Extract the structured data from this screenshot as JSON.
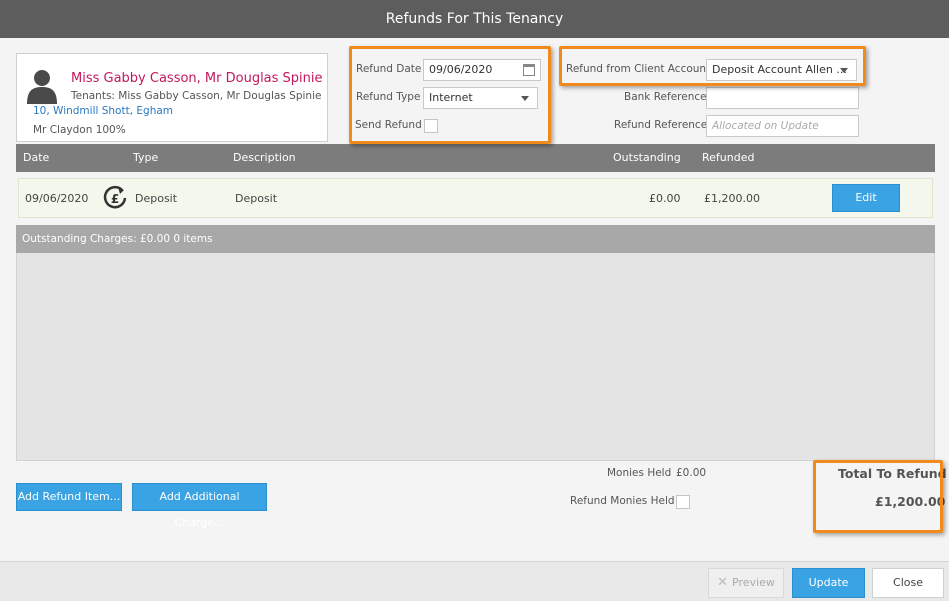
{
  "dialog": {
    "title": "Refunds For This Tenancy"
  },
  "tenant": {
    "name": "Miss Gabby Casson, Mr Douglas Spinie",
    "tenants_line": "Tenants: Miss Gabby Casson, Mr Douglas Spinie",
    "address": "10, Windmill Shott, Egham",
    "landlord": "Mr Claydon 100%",
    "avatar_icon": "person-silhouette-icon"
  },
  "form": {
    "refund_date_label": "Refund Date",
    "refund_date_value": "09/06/2020",
    "refund_type_label": "Refund Type",
    "refund_type_value": "Internet",
    "send_refund_label": "Send Refund",
    "send_refund_checked": false,
    "client_account_label": "Refund from Client Account",
    "client_account_value": "Deposit Account Allen ...",
    "bank_reference_label": "Bank Reference",
    "bank_reference_value": "",
    "refund_reference_label": "Refund Reference",
    "refund_reference_placeholder": "Allocated on Update"
  },
  "grid": {
    "columns": [
      "Date",
      "Type",
      "Description",
      "Outstanding",
      "Refunded"
    ],
    "rows": [
      {
        "date": "09/06/2020",
        "type": "Deposit",
        "description": "Deposit",
        "outstanding": "£0.00",
        "refunded": "£1,200.00",
        "action": "Edit",
        "icon": "pound-refund-icon"
      }
    ],
    "outstanding_summary": "Outstanding Charges: £0.00 0 items"
  },
  "actions": {
    "add_refund_item": "Add Refund Item...",
    "add_additional_charge": "Add Additional Charge..."
  },
  "totals": {
    "monies_held_label": "Monies Held",
    "monies_held_value": "£0.00",
    "refund_monies_held_label": "Refund Monies Held",
    "total_to_refund_label": "Total To Refund",
    "total_to_refund_value": "£1,200.00"
  },
  "footer": {
    "preview": "Preview",
    "update": "Update",
    "close": "Close"
  },
  "colors": {
    "highlight": "#f08a1c",
    "accent_blue": "#3aa3e3",
    "tenant_name": "#c2185b"
  }
}
